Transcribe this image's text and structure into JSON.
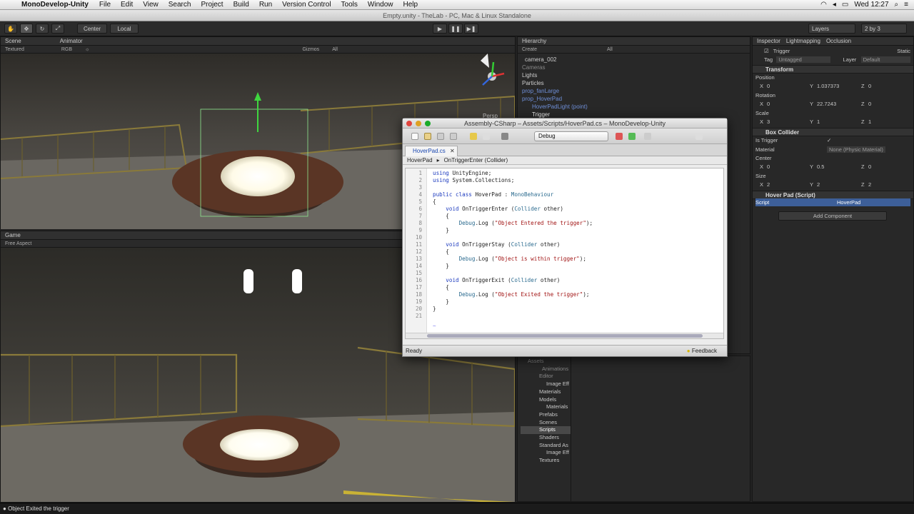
{
  "menubar": {
    "app": "MonoDevelop-Unity",
    "items": [
      "File",
      "Edit",
      "View",
      "Search",
      "Project",
      "Build",
      "Run",
      "Version Control",
      "Tools",
      "Window",
      "Help"
    ],
    "clock": "Wed 12:27"
  },
  "window_title": "Empty.unity - TheLab - PC, Mac & Linux Standalone",
  "toolbar": {
    "pivot": "Center",
    "space": "Local",
    "layers": "Layers",
    "layout": "2 by 3"
  },
  "scene_panel": {
    "tabs": [
      "Scene",
      "Animator"
    ],
    "shading": "Textured",
    "render": "RGB",
    "gizmos": "Gizmos",
    "search": "All",
    "persp": "Persp"
  },
  "game_panel": {
    "tab": "Game",
    "aspect": "Free Aspect"
  },
  "hierarchy": {
    "tab": "Hierarchy",
    "create": "Create",
    "search": "All",
    "items": [
      {
        "label": "camera_002",
        "style": "white"
      },
      {
        "label": "Cameras",
        "style": "grey"
      },
      {
        "label": "Lights",
        "style": "white"
      },
      {
        "label": "Particles",
        "style": "white"
      },
      {
        "label": "prop_fanLarge",
        "style": "blue"
      },
      {
        "label": "prop_HoverPad",
        "style": "blue"
      },
      {
        "label": "HoverPadLight (point)",
        "style": "blue"
      },
      {
        "label": "Trigger",
        "style": "white"
      }
    ]
  },
  "inspector": {
    "tabs": [
      "Inspector",
      "Lightmapping",
      "Occlusion"
    ],
    "object_name": "Trigger",
    "static": "Static",
    "tag_label": "Tag",
    "tag_value": "Untagged",
    "layer_label": "Layer",
    "layer_value": "Default",
    "transform": {
      "title": "Transform",
      "position": {
        "label": "Position",
        "x": "0",
        "y": "1.037373",
        "z": "0"
      },
      "rotation": {
        "label": "Rotation",
        "x": "0",
        "y": "22.7243",
        "z": "0"
      },
      "scale": {
        "label": "Scale",
        "x": "3",
        "y": "1",
        "z": "1"
      }
    },
    "box_collider": {
      "title": "Box Collider",
      "is_trigger_label": "Is Trigger",
      "is_trigger_value": "✓",
      "material_label": "Material",
      "material_value": "None (Physic Material)",
      "center": {
        "label": "Center",
        "x": "0",
        "y": "0.5",
        "z": "0"
      },
      "size": {
        "label": "Size",
        "x": "2",
        "y": "2",
        "z": "2"
      }
    },
    "script_component": {
      "title": "Hover Pad (Script)",
      "script_label": "Script",
      "script_value": "HoverPad"
    },
    "add_component": "Add Component"
  },
  "project": {
    "items": [
      {
        "label": "Assets",
        "indent": 0
      },
      {
        "label": "Animations",
        "indent": 1
      },
      {
        "label": "Editor",
        "indent": 1
      },
      {
        "label": "Image Eff",
        "indent": 2
      },
      {
        "label": "Materials",
        "indent": 1
      },
      {
        "label": "Models",
        "indent": 1
      },
      {
        "label": "Materials",
        "indent": 2
      },
      {
        "label": "Prefabs",
        "indent": 1
      },
      {
        "label": "Scenes",
        "indent": 1
      },
      {
        "label": "Scripts",
        "indent": 1,
        "selected": true
      },
      {
        "label": "Shaders",
        "indent": 1
      },
      {
        "label": "Standard As",
        "indent": 1
      },
      {
        "label": "Image Eff",
        "indent": 2
      },
      {
        "label": "Textures",
        "indent": 1
      }
    ]
  },
  "monodevelop": {
    "title": "Assembly-CSharp – Assets/Scripts/HoverPad.cs – MonoDevelop-Unity",
    "config": "Debug",
    "tab": "HoverPad.cs",
    "breadcrumb_class": "HoverPad",
    "breadcrumb_method": "OnTriggerEnter (Collider)",
    "status": "Ready",
    "feedback": "Feedback",
    "code": [
      "using UnityEngine;",
      "using System.Collections;",
      "",
      "public class HoverPad : MonoBehaviour",
      "{",
      "    void OnTriggerEnter (Collider other)",
      "    {",
      "        Debug.Log (\"Object Entered the trigger\");",
      "    }",
      "",
      "    void OnTriggerStay (Collider other)",
      "    {",
      "        Debug.Log (\"Object is within trigger\");",
      "    }",
      "",
      "    void OnTriggerExit (Collider other)",
      "    {",
      "        Debug.Log (\"Object Exited the trigger\");",
      "    }",
      "}",
      ""
    ]
  },
  "statusbar": {
    "message": "Object Exited the trigger"
  },
  "colors": {
    "unity_bg": "#282828",
    "selection": "#3d5f99",
    "keyword": "#1d3bbf",
    "string": "#a21515"
  }
}
